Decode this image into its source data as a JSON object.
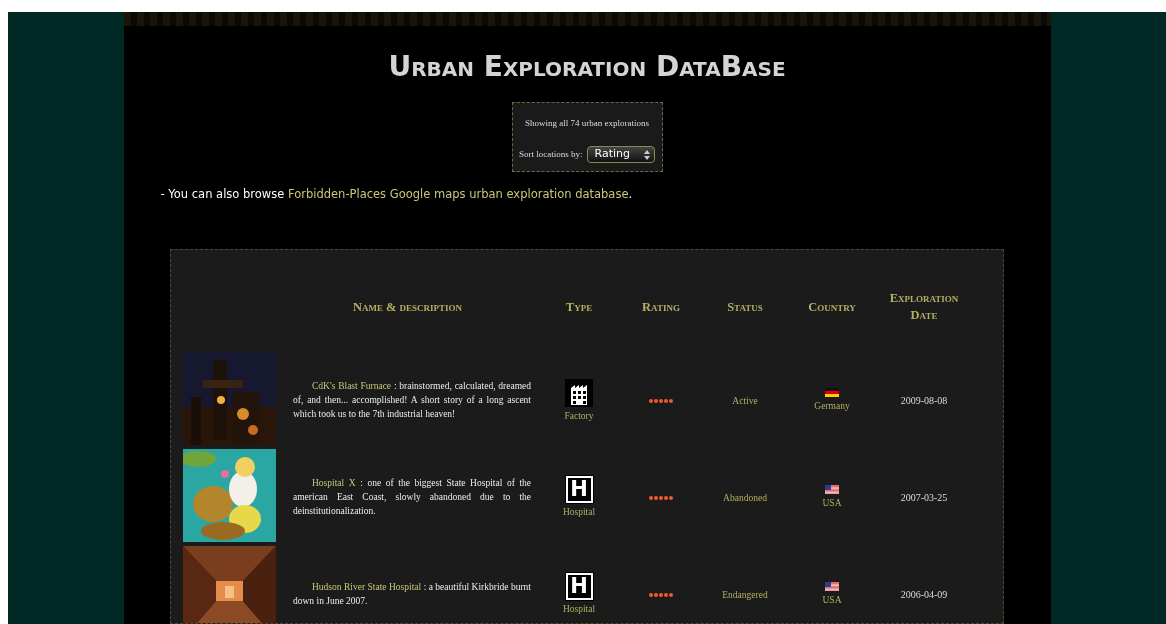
{
  "title": "Urban Exploration DataBase",
  "summary": {
    "text": "Showing all 74 urban explorations",
    "sort_label": "Sort locations by:",
    "sort_value": "Rating"
  },
  "browse_note": {
    "prefix": "- You can also browse ",
    "link": "Forbidden-Places Google maps urban exploration database",
    "suffix": "."
  },
  "table": {
    "columns": [
      "Name & description",
      "Type",
      "Rating",
      "Status",
      "Country",
      "Exploration Date"
    ],
    "rows": [
      {
        "picture": {
          "kind": "furnace"
        },
        "name": "CdK's Blast Furnace",
        "description": " : brainstormed, calculated, dreamed of, and then... accomplished! A short story of a long ascent which took us to the 7th industrial heaven!",
        "type": {
          "kind": "factory",
          "label": "Factory"
        },
        "stars": 5,
        "status": "Active",
        "country": {
          "kind": "germany",
          "label": "Germany"
        },
        "date": "2009-08-08"
      },
      {
        "picture": {
          "kind": "mural"
        },
        "name": "Hospital X",
        "description": " : one of the biggest State Hospital of the american East Coast, slowly abandoned due to the deinstitutionalization.",
        "type": {
          "kind": "hospital",
          "label": "Hospital",
          "glyph": "H"
        },
        "stars": 5,
        "status": "Abandoned",
        "country": {
          "kind": "usa",
          "label": "USA"
        },
        "date": "2007-03-25"
      },
      {
        "picture": {
          "kind": "corridor"
        },
        "name": "Hudson River State Hospital",
        "description": " : a beautiful Kirkbride burnt down in June 2007.",
        "type": {
          "kind": "hospital",
          "label": "Hospital",
          "glyph": "H"
        },
        "stars": 5,
        "status": "Endangered",
        "country": {
          "kind": "usa",
          "label": "USA"
        },
        "date": "2006-04-09"
      }
    ]
  }
}
